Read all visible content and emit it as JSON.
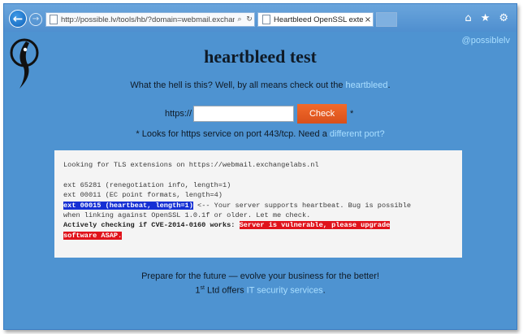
{
  "browser": {
    "address": "http://possible.lv/tools/hb/?domain=webmail.exchangelabs.nl",
    "tab_title": "Heartbleed OpenSSL extens...",
    "tab_close": "×",
    "back": "←",
    "forward": "→"
  },
  "page": {
    "twitter": "@possiblelv",
    "title": "heartbleed test",
    "subtitle_prefix": "What the hell is this? Well, by all means check out the ",
    "subtitle_link": "heartbleed",
    "subtitle_suffix": ".",
    "form": {
      "protocol_label": "https://",
      "input_value": "",
      "button_label": "Check",
      "asterisk": "*"
    },
    "note_prefix": "* Looks for https service on port 443/tcp. Need a ",
    "note_link": "different port?",
    "result": {
      "heading": "Looking for TLS extensions on https://webmail.exchangelabs.nl",
      "ext1": "ext 65281 (renegotiation info, length=1)",
      "ext2": "ext 00011 (EC point formats, length=4)",
      "ext3_highlight": "ext 00015 (heartbeat, length=1)",
      "ext3_tail": " <-- Your server supports heartbeat. Bug is possible",
      "ext3_cont": "when linking against OpenSSL 1.0.1f or older. Let me check.",
      "check_label": "Actively checking if CVE-2014-0160 works: ",
      "vuln_part1": "Server is vulnerable, please upgrade",
      "vuln_part2": "software ASAP."
    },
    "footer_line1": "Prepare for the future — evolve your business for the better!",
    "footer_company": "1",
    "footer_company_sup": "st",
    "footer_company_rest": " Ltd offers ",
    "footer_link": "IT security services",
    "footer_suffix": "."
  },
  "colors": {
    "page_bg": "#4e93d1",
    "link": "#a9deff",
    "button": "#e85a22",
    "highlight_blue": "#1530d4",
    "highlight_red": "#e0131b"
  }
}
